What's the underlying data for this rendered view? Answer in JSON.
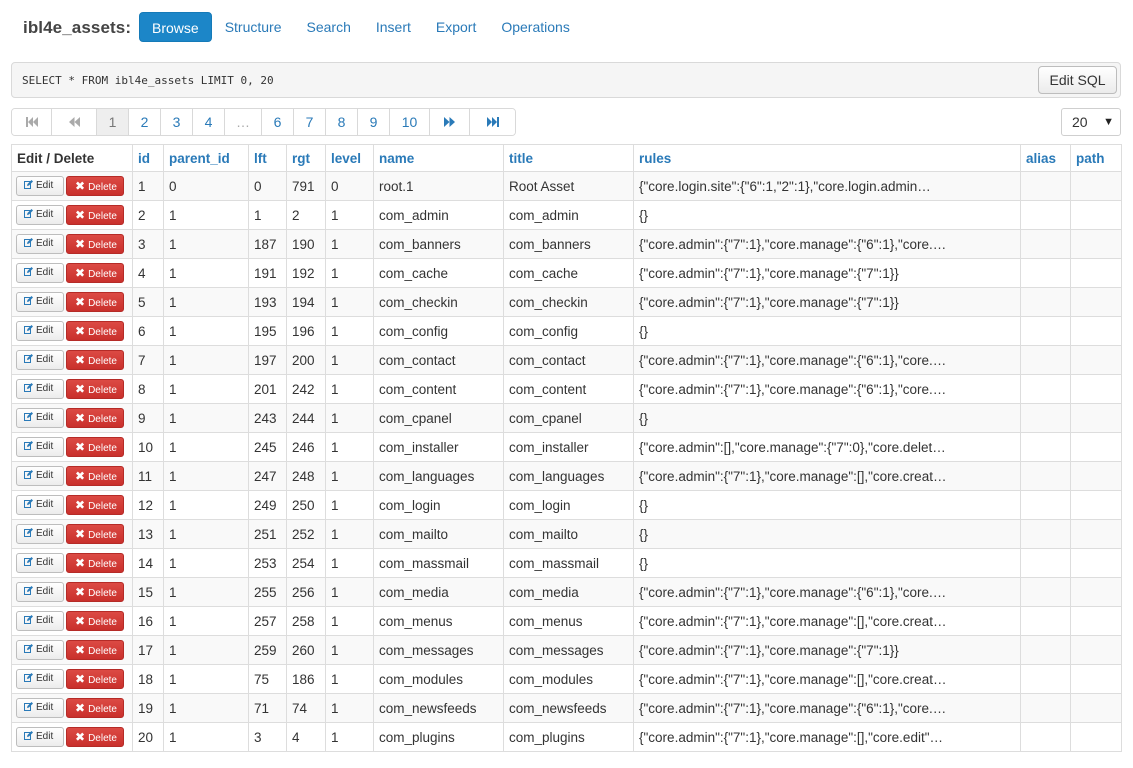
{
  "header": {
    "table_name": "ibl4e_assets:",
    "nav": [
      "Browse",
      "Structure",
      "Search",
      "Insert",
      "Export",
      "Operations"
    ],
    "active": "Browse"
  },
  "sql": {
    "query": "SELECT * FROM ibl4e_assets LIMIT 0, 20",
    "edit_label": "Edit SQL"
  },
  "pagination": {
    "pages": [
      "1",
      "2",
      "3",
      "4",
      "…",
      "6",
      "7",
      "8",
      "9",
      "10"
    ],
    "current": "1",
    "per_page": "20"
  },
  "table": {
    "columns": [
      "Edit / Delete",
      "id",
      "parent_id",
      "lft",
      "rgt",
      "level",
      "name",
      "title",
      "rules",
      "alias",
      "path"
    ],
    "edit_label": "Edit",
    "delete_label": "Delete",
    "rows": [
      [
        "1",
        "0",
        "0",
        "791",
        "0",
        "root.1",
        "Root Asset",
        "{\"core.login.site\":{\"6\":1,\"2\":1},\"core.login.admin…",
        "",
        ""
      ],
      [
        "2",
        "1",
        "1",
        "2",
        "1",
        "com_admin",
        "com_admin",
        "{}",
        "",
        ""
      ],
      [
        "3",
        "1",
        "187",
        "190",
        "1",
        "com_banners",
        "com_banners",
        "{\"core.admin\":{\"7\":1},\"core.manage\":{\"6\":1},\"core.…",
        "",
        ""
      ],
      [
        "4",
        "1",
        "191",
        "192",
        "1",
        "com_cache",
        "com_cache",
        "{\"core.admin\":{\"7\":1},\"core.manage\":{\"7\":1}}",
        "",
        ""
      ],
      [
        "5",
        "1",
        "193",
        "194",
        "1",
        "com_checkin",
        "com_checkin",
        "{\"core.admin\":{\"7\":1},\"core.manage\":{\"7\":1}}",
        "",
        ""
      ],
      [
        "6",
        "1",
        "195",
        "196",
        "1",
        "com_config",
        "com_config",
        "{}",
        "",
        ""
      ],
      [
        "7",
        "1",
        "197",
        "200",
        "1",
        "com_contact",
        "com_contact",
        "{\"core.admin\":{\"7\":1},\"core.manage\":{\"6\":1},\"core.…",
        "",
        ""
      ],
      [
        "8",
        "1",
        "201",
        "242",
        "1",
        "com_content",
        "com_content",
        "{\"core.admin\":{\"7\":1},\"core.manage\":{\"6\":1},\"core.…",
        "",
        ""
      ],
      [
        "9",
        "1",
        "243",
        "244",
        "1",
        "com_cpanel",
        "com_cpanel",
        "{}",
        "",
        ""
      ],
      [
        "10",
        "1",
        "245",
        "246",
        "1",
        "com_installer",
        "com_installer",
        "{\"core.admin\":[],\"core.manage\":{\"7\":0},\"core.delet…",
        "",
        ""
      ],
      [
        "11",
        "1",
        "247",
        "248",
        "1",
        "com_languages",
        "com_languages",
        "{\"core.admin\":{\"7\":1},\"core.manage\":[],\"core.creat…",
        "",
        ""
      ],
      [
        "12",
        "1",
        "249",
        "250",
        "1",
        "com_login",
        "com_login",
        "{}",
        "",
        ""
      ],
      [
        "13",
        "1",
        "251",
        "252",
        "1",
        "com_mailto",
        "com_mailto",
        "{}",
        "",
        ""
      ],
      [
        "14",
        "1",
        "253",
        "254",
        "1",
        "com_massmail",
        "com_massmail",
        "{}",
        "",
        ""
      ],
      [
        "15",
        "1",
        "255",
        "256",
        "1",
        "com_media",
        "com_media",
        "{\"core.admin\":{\"7\":1},\"core.manage\":{\"6\":1},\"core.…",
        "",
        ""
      ],
      [
        "16",
        "1",
        "257",
        "258",
        "1",
        "com_menus",
        "com_menus",
        "{\"core.admin\":{\"7\":1},\"core.manage\":[],\"core.creat…",
        "",
        ""
      ],
      [
        "17",
        "1",
        "259",
        "260",
        "1",
        "com_messages",
        "com_messages",
        "{\"core.admin\":{\"7\":1},\"core.manage\":{\"7\":1}}",
        "",
        ""
      ],
      [
        "18",
        "1",
        "75",
        "186",
        "1",
        "com_modules",
        "com_modules",
        "{\"core.admin\":{\"7\":1},\"core.manage\":[],\"core.creat…",
        "",
        ""
      ],
      [
        "19",
        "1",
        "71",
        "74",
        "1",
        "com_newsfeeds",
        "com_newsfeeds",
        "{\"core.admin\":{\"7\":1},\"core.manage\":{\"6\":1},\"core.…",
        "",
        ""
      ],
      [
        "20",
        "1",
        "3",
        "4",
        "1",
        "com_plugins",
        "com_plugins",
        "{\"core.admin\":{\"7\":1},\"core.manage\":[],\"core.edit\"…",
        "",
        ""
      ]
    ]
  }
}
